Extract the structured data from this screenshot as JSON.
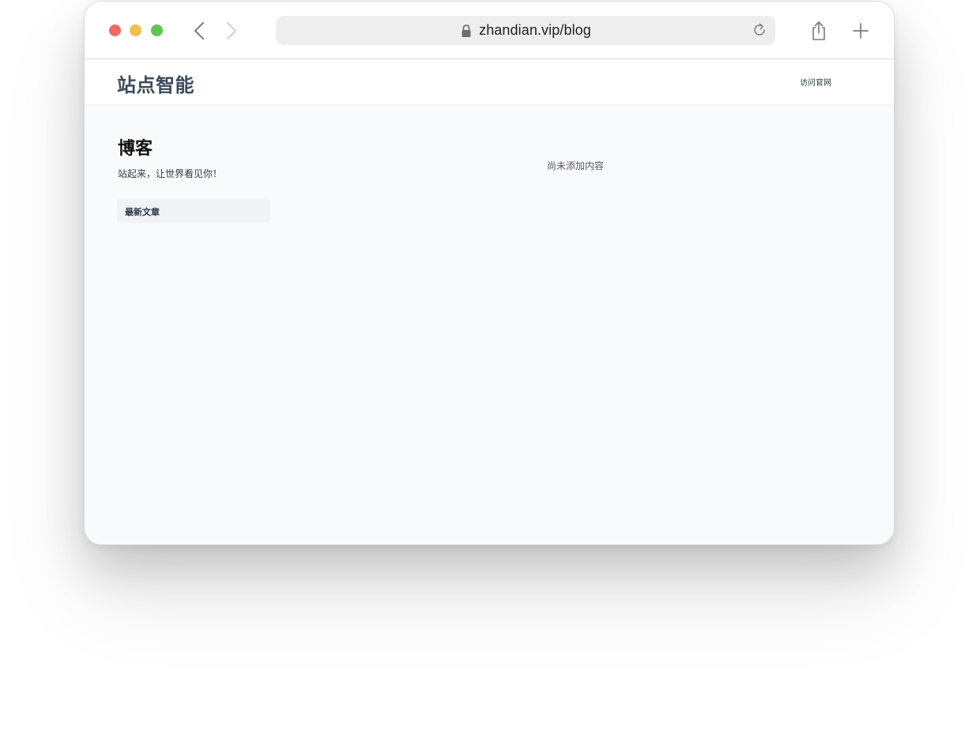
{
  "browser": {
    "url": "zhandian.vip/blog",
    "icons": {
      "back": "chevron-left-icon",
      "forward": "chevron-right-icon",
      "lock": "lock-icon",
      "reload": "reload-icon",
      "share": "share-icon",
      "new_tab": "plus-icon"
    },
    "colors": {
      "close": "#ec6a5e",
      "minimize": "#f4bf4f",
      "zoom": "#61c554"
    }
  },
  "site": {
    "brand": "站点智能",
    "nav_link": "访问官网"
  },
  "blog": {
    "title": "博客",
    "subtitle": "站起来，让世界看见你！",
    "sidebar_heading": "最新文章",
    "empty_message": "尚未添加内容"
  }
}
